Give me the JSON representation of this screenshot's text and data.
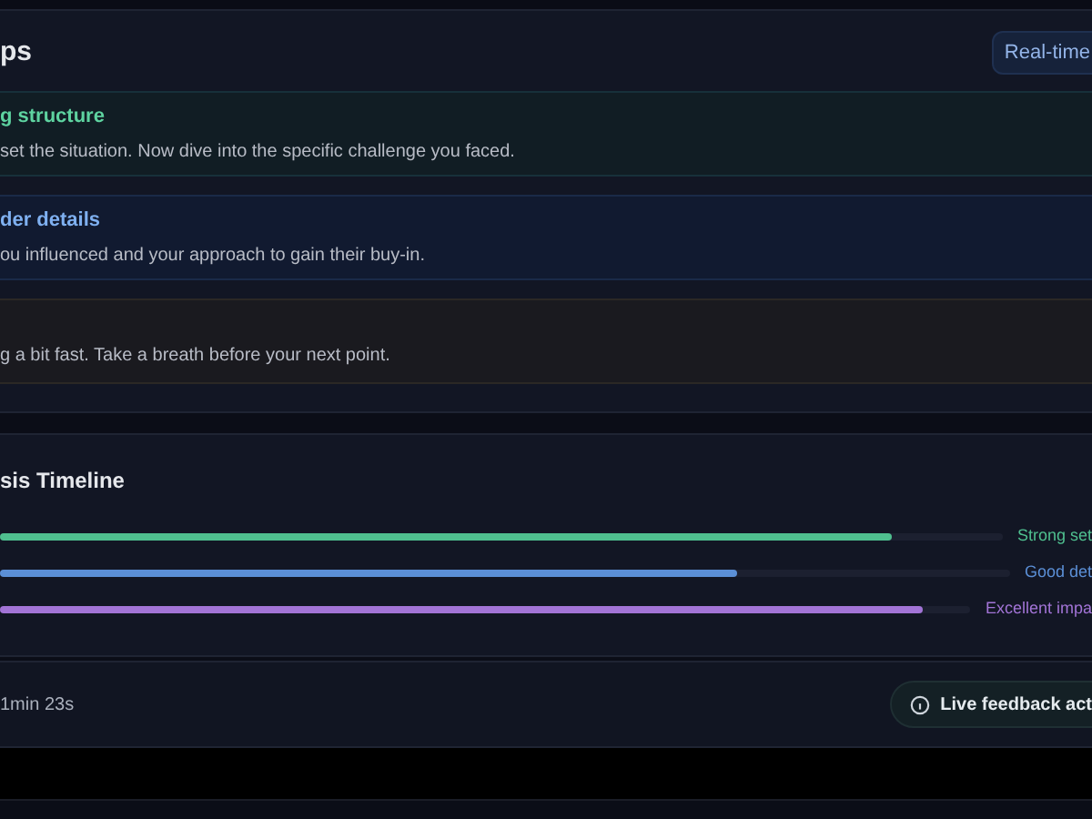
{
  "tips": {
    "title": "ps",
    "badge": "Real-time",
    "cards": [
      {
        "kind": "success",
        "title": "g structure",
        "text": "set the situation. Now dive into the specific challenge you faced."
      },
      {
        "kind": "info",
        "title": "der details",
        "text": "ou influenced and your approach to gain their buy-in."
      },
      {
        "kind": "warning",
        "text": "g a bit fast. Take a breath before your next point."
      }
    ]
  },
  "timeline": {
    "title": "sis Timeline",
    "bars": [
      {
        "label": "Strong set",
        "level": 0.89,
        "color": "#4fbf8f"
      },
      {
        "label": "Good det",
        "level": 0.73,
        "color": "#5b8fd6"
      },
      {
        "label": "Excellent impa",
        "level": 0.95,
        "color": "#a274d6"
      }
    ]
  },
  "footer": {
    "duration": "1min 23s",
    "status": "Live feedback act"
  }
}
